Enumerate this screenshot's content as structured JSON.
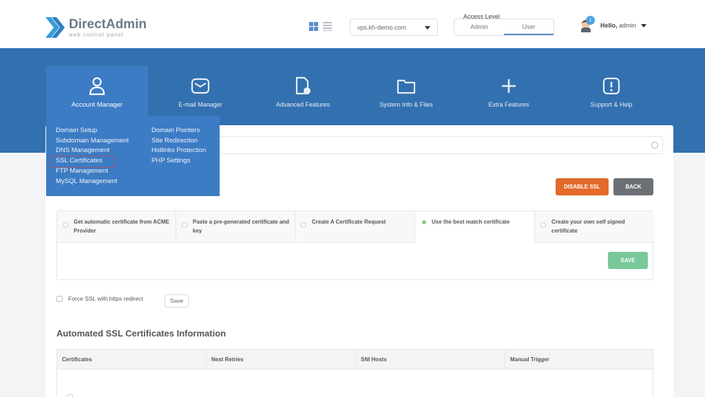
{
  "header": {
    "logo_name": "DirectAdmin",
    "logo_tagline": "web control panel",
    "server": "vps.kh-demo.com",
    "access_level_label": "Access Level",
    "access_options": [
      "Admin",
      "User"
    ],
    "notification_count": "1",
    "greeting_prefix": "Hello,",
    "username": "admin"
  },
  "nav": {
    "items": [
      {
        "label": "Account Manager",
        "icon": "user-icon"
      },
      {
        "label": "E-mail Manager",
        "icon": "mail-icon"
      },
      {
        "label": "Advanced Features",
        "icon": "document-gear-icon"
      },
      {
        "label": "System Info & Files",
        "icon": "folder-icon"
      },
      {
        "label": "Extra Features",
        "icon": "plus-icon"
      },
      {
        "label": "Support & Help",
        "icon": "alert-icon"
      }
    ]
  },
  "dropdown": {
    "col1": [
      "Domain Setup",
      "Subdomain Management",
      "DNS Management",
      "SSL Certificates",
      "FTP Management",
      "MySQL Management"
    ],
    "col2": [
      "Domain Pointers",
      "Site Redirection",
      "Hotlinks Protection",
      "PHP Settings"
    ]
  },
  "actions": {
    "disable_ssl": "DISABLE SSL",
    "back": "BACK",
    "save": "SAVE"
  },
  "options": [
    "Get automatic certificate from ACME Provider",
    "Paste a pre-generated certificate and key",
    "Create A Certificate Request",
    "Use the best match certificate",
    "Create your own self signed certificate"
  ],
  "force_ssl": {
    "label": "Force SSL with https redirect",
    "save_label": "Save"
  },
  "automated": {
    "title": "Automated SSL Certificates Information",
    "columns": [
      "Certificates",
      "Next Retries",
      "SNI Hosts",
      "Manual Trigger"
    ]
  },
  "colors": {
    "nav_blue": "#3370b0",
    "active_blue": "#3c7cc4",
    "disable_orange": "#e36a2a",
    "back_gray": "#6c6f73",
    "save_green": "#79c89a",
    "highlight_red": "#e23b3b"
  }
}
